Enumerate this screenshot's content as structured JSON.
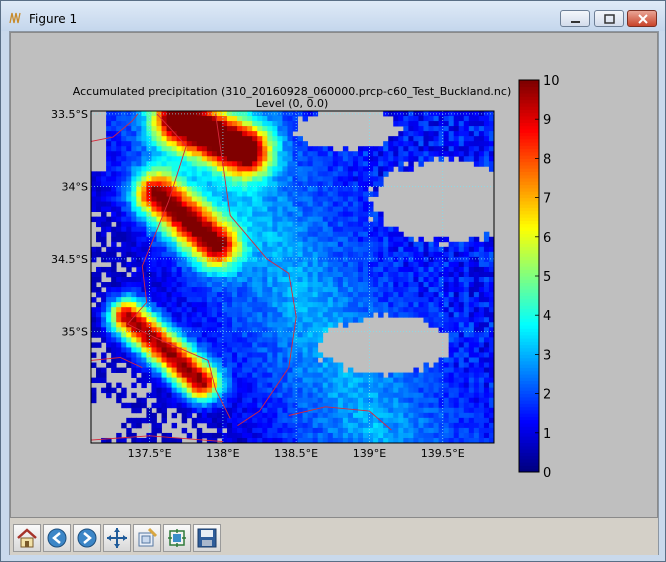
{
  "window": {
    "title": "Figure 1",
    "buttons": {
      "minimize": "minimize",
      "maximize": "maximize",
      "close": "close"
    }
  },
  "plot": {
    "title_line1": "Accumulated precipitation (310_20160928_060000.prcp-c60_Test_Buckland.nc)",
    "title_line2": "Level  (0, 0.0)",
    "x_ticks": [
      "137.5°E",
      "138°E",
      "138.5°E",
      "139°E",
      "139.5°E"
    ],
    "y_ticks": [
      "33.5°S",
      "34°S",
      "34.5°S",
      "35°S"
    ],
    "colorbar_ticks": [
      "10",
      "9",
      "8",
      "7",
      "6",
      "5",
      "4",
      "3",
      "2",
      "1",
      "0"
    ]
  },
  "chart_data": {
    "type": "heatmap",
    "title": "Accumulated precipitation (310_20160928_060000.prcp-c60_Test_Buckland.nc)",
    "subtitle": "Level  (0, 0.0)",
    "x_ticks": [
      137.5,
      138.0,
      138.5,
      139.0,
      139.5
    ],
    "y_ticks": [
      -33.5,
      -34.0,
      -34.5,
      -35.0
    ],
    "xlim": [
      137.1,
      139.85
    ],
    "ylim": [
      -35.77,
      -33.48
    ],
    "colorbar": {
      "min": 0,
      "max": 10,
      "ticks": [
        0,
        1,
        2,
        3,
        4,
        5,
        6,
        7,
        8,
        9,
        10
      ],
      "colormap": "jet"
    },
    "grid": true,
    "features": {
      "bands": [
        {
          "x0": 137.7,
          "y0": -33.55,
          "x1": 138.15,
          "y1": -33.75,
          "peak": 9.8,
          "width": 0.12
        },
        {
          "x0": 137.55,
          "y0": -34.05,
          "x1": 137.95,
          "y1": -34.4,
          "peak": 8.6,
          "width": 0.11
        },
        {
          "x0": 137.35,
          "y0": -34.9,
          "x1": 137.85,
          "y1": -35.35,
          "peak": 9.2,
          "width": 0.09
        }
      ],
      "dry_regions": [
        {
          "lon": 139.55,
          "lat": -34.1,
          "rx": 0.55,
          "ry": 0.28
        },
        {
          "lon": 139.1,
          "lat": -35.1,
          "rx": 0.45,
          "ry": 0.2
        },
        {
          "lon": 138.85,
          "lat": -33.6,
          "rx": 0.35,
          "ry": 0.15
        },
        {
          "lon": 137.2,
          "lat": -35.6,
          "rx": 0.12,
          "ry": 0.15
        }
      ]
    }
  },
  "toolbar": {
    "home": "home-icon",
    "back": "back-icon",
    "forward": "forward-icon",
    "pan": "pan-icon",
    "zoom": "zoom-icon",
    "subplots": "subplots-icon",
    "save": "save-icon"
  }
}
